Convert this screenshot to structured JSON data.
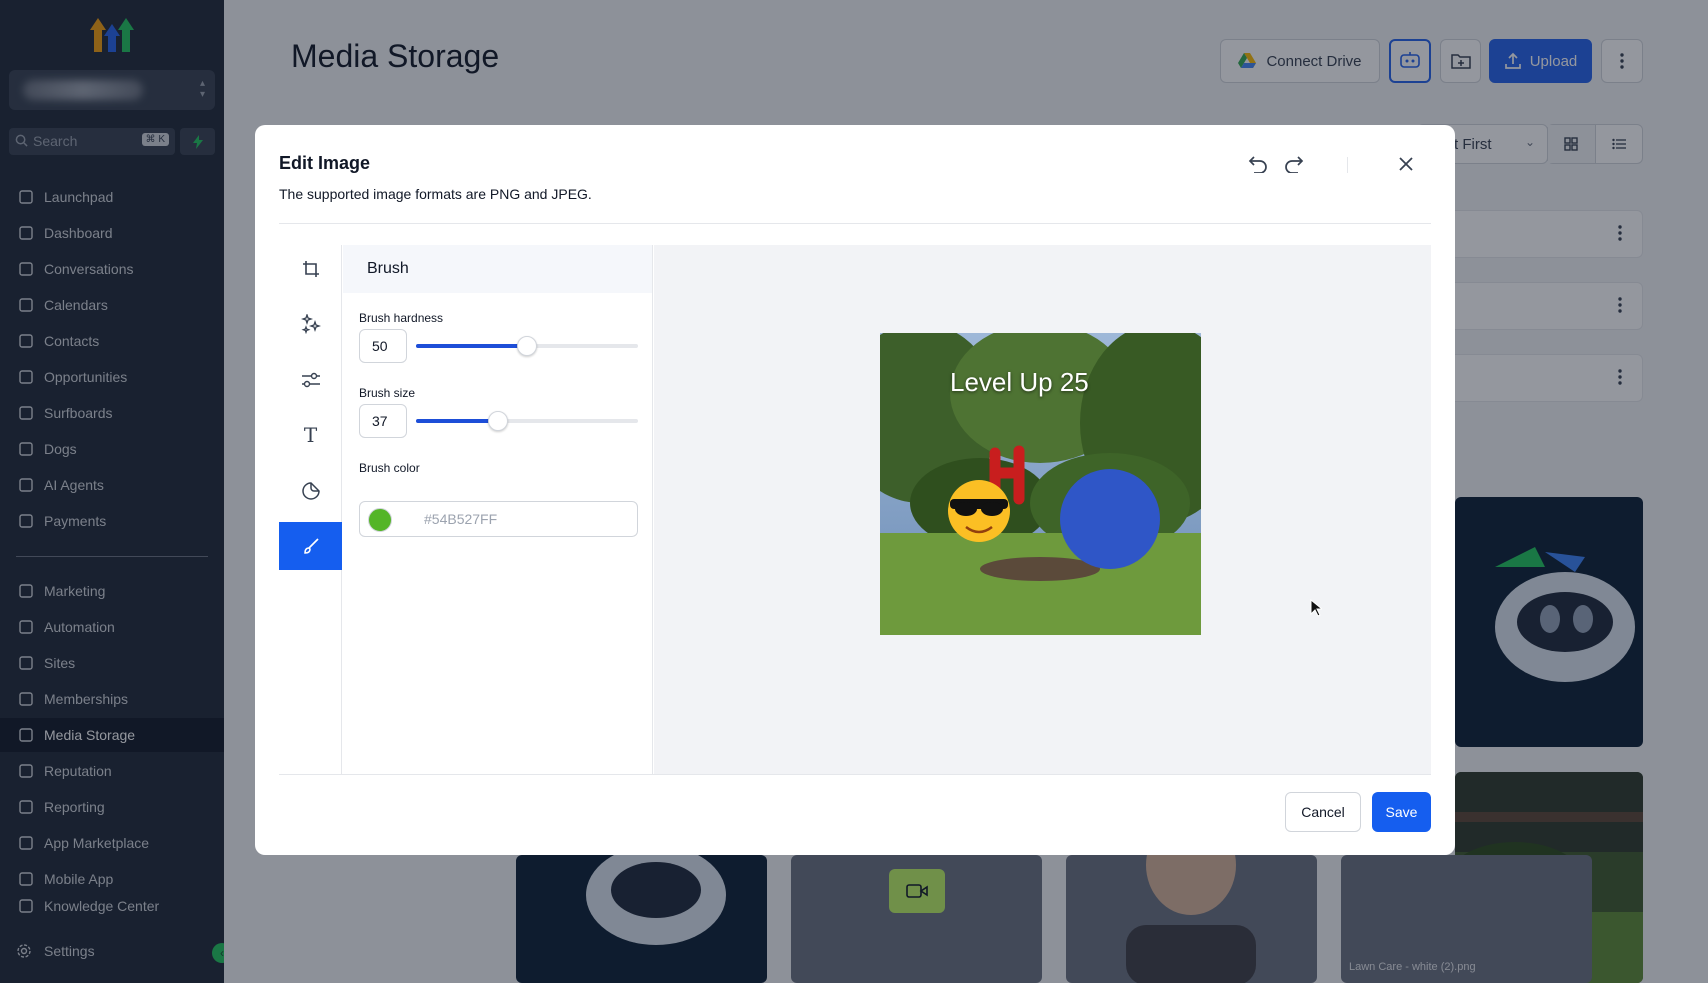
{
  "sidebar": {
    "search_placeholder": "Search",
    "search_shortcut": "⌘ K",
    "items": [
      {
        "label": "Launchpad",
        "icon": "rocket-icon"
      },
      {
        "label": "Dashboard",
        "icon": "grid-icon"
      },
      {
        "label": "Conversations",
        "icon": "chat-icon"
      },
      {
        "label": "Calendars",
        "icon": "calendar-icon"
      },
      {
        "label": "Contacts",
        "icon": "contacts-icon"
      },
      {
        "label": "Opportunities",
        "icon": "network-icon"
      },
      {
        "label": "Surfboards",
        "icon": "surfboard-icon"
      },
      {
        "label": "Dogs",
        "icon": "paw-icon"
      },
      {
        "label": "AI Agents",
        "icon": "sparkle-icon"
      },
      {
        "label": "Payments",
        "icon": "receipt-icon"
      },
      {
        "label": "Marketing",
        "icon": "send-icon"
      },
      {
        "label": "Automation",
        "icon": "play-circle-icon"
      },
      {
        "label": "Sites",
        "icon": "globe-icon"
      },
      {
        "label": "Memberships",
        "icon": "award-icon"
      },
      {
        "label": "Media Storage",
        "icon": "image-icon"
      },
      {
        "label": "Reputation",
        "icon": "star-icon"
      },
      {
        "label": "Reporting",
        "icon": "trend-icon"
      },
      {
        "label": "App Marketplace",
        "icon": "apps-icon"
      },
      {
        "label": "Mobile App",
        "icon": "phone-icon"
      },
      {
        "label": "Knowledge Center",
        "icon": "book-icon"
      }
    ],
    "settings_label": "Settings",
    "active_item": "Media Storage"
  },
  "header": {
    "title": "Media Storage",
    "connect_drive_label": "Connect Drive",
    "upload_label": "Upload",
    "sort_label": "t First"
  },
  "thumbnails": {
    "lawn_care_label": "Lawn Care - white (2).png"
  },
  "modal": {
    "title": "Edit Image",
    "subtitle": "The supported image formats are PNG and JPEG.",
    "panel_title": "Brush",
    "hardness": {
      "label": "Brush hardness",
      "value": "50",
      "fraction": 0.5
    },
    "size": {
      "label": "Brush size",
      "value": "37",
      "fraction": 0.37
    },
    "color": {
      "label": "Brush color",
      "value": "#54B527FF",
      "swatch": "#54B527"
    },
    "image_text": "Level Up 25",
    "cancel_label": "Cancel",
    "save_label": "Save"
  },
  "colors": {
    "accent": "#155eef",
    "sidebar_bg": "#1f2937"
  }
}
